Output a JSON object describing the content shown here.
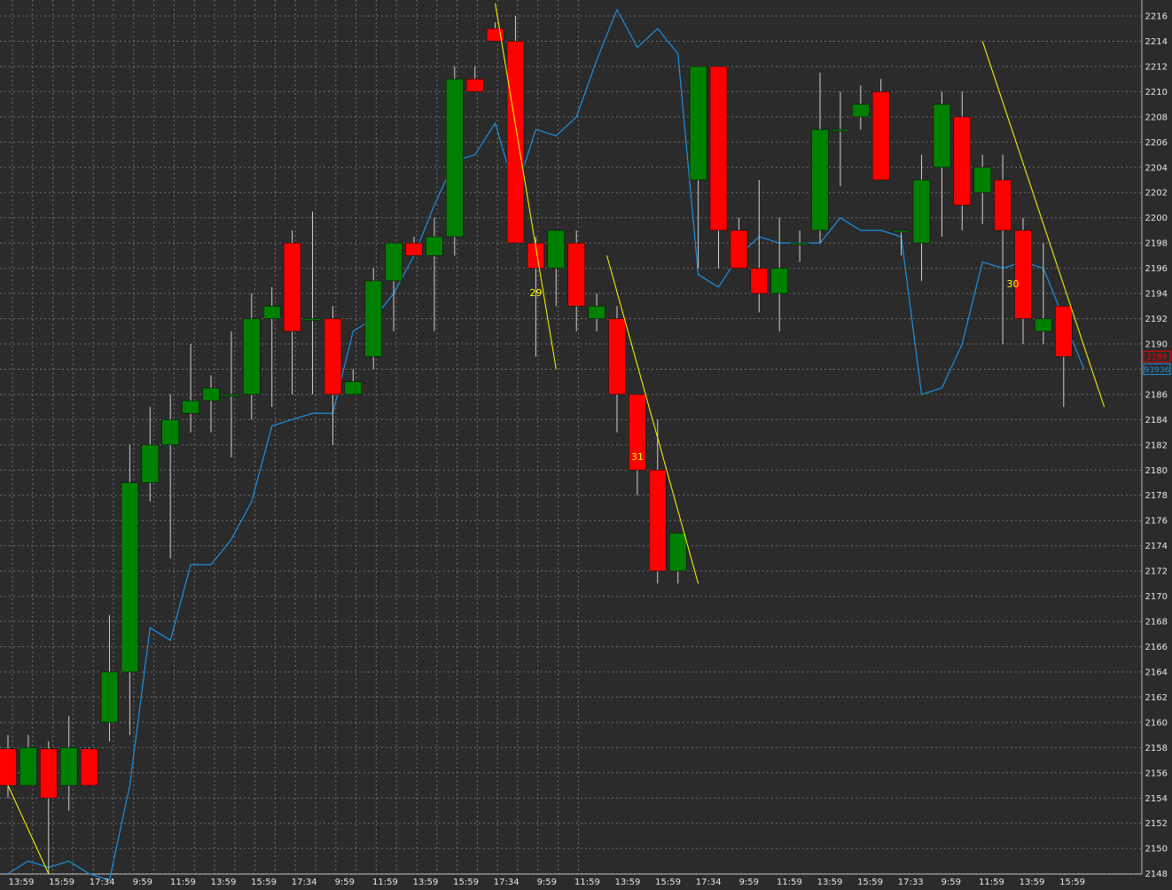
{
  "chart_data": {
    "type": "candlestick",
    "ylim": [
      2147,
      2217
    ],
    "y_ticks": [
      2148,
      2150,
      2152,
      2154,
      2156,
      2158,
      2160,
      2162,
      2164,
      2166,
      2168,
      2170,
      2172,
      2174,
      2176,
      2178,
      2180,
      2182,
      2184,
      2186,
      2188,
      2190,
      2192,
      2194,
      2196,
      2198,
      2200,
      2202,
      2204,
      2206,
      2208,
      2210,
      2212,
      2214,
      2216
    ],
    "x_tick_labels": [
      "13:59",
      "15:59",
      "17:34",
      "9:59",
      "11:59",
      "13:59",
      "15:59",
      "17:34",
      "9:59",
      "11:59",
      "13:59",
      "15:59",
      "17:34",
      "9:59",
      "11:59",
      "13:59",
      "15:59",
      "17:34",
      "9:59",
      "11:59",
      "13:59",
      "15:59",
      "17:33",
      "9:59",
      "11:59",
      "13:59",
      "15:59"
    ],
    "grid": true,
    "colors": {
      "background": "#2b2b2b",
      "grid": "#6e6e6e",
      "up": "#008000",
      "down": "#ff0000",
      "wick": "#d0d0d0",
      "indicator": "#1e90e0",
      "trendline": "#ffff00",
      "axis_text": "#e6e6e6"
    },
    "candles": [
      {
        "o": 2157.9,
        "h": 2159.0,
        "l": 2154.0,
        "c": 2155.0
      },
      {
        "o": 2155.0,
        "h": 2159.0,
        "l": 2155.0,
        "c": 2158.0
      },
      {
        "o": 2157.9,
        "h": 2158.5,
        "l": 2148.0,
        "c": 2154.0
      },
      {
        "o": 2155.0,
        "h": 2160.5,
        "l": 2153.0,
        "c": 2158.0
      },
      {
        "o": 2157.9,
        "h": 2158.0,
        "l": 2155.0,
        "c": 2155.0
      },
      {
        "o": 2160.0,
        "h": 2168.5,
        "l": 2158.5,
        "c": 2164.0
      },
      {
        "o": 2164.0,
        "h": 2182.0,
        "l": 2159.0,
        "c": 2179.0
      },
      {
        "o": 2179.0,
        "h": 2185.0,
        "l": 2177.5,
        "c": 2182.0
      },
      {
        "o": 2182.0,
        "h": 2186.0,
        "l": 2173.0,
        "c": 2184.0
      },
      {
        "o": 2184.5,
        "h": 2190.0,
        "l": 2183.0,
        "c": 2185.5
      },
      {
        "o": 2185.5,
        "h": 2187.5,
        "l": 2183.0,
        "c": 2186.5
      },
      {
        "o": 2186.0,
        "h": 2191.0,
        "l": 2181.0,
        "c": 2186.0
      },
      {
        "o": 2186.0,
        "h": 2194.0,
        "l": 2184.0,
        "c": 2192.0
      },
      {
        "o": 2192.0,
        "h": 2194.5,
        "l": 2185.0,
        "c": 2193.0
      },
      {
        "o": 2198.0,
        "h": 2199.0,
        "l": 2186.0,
        "c": 2191.0
      },
      {
        "o": 2192.0,
        "h": 2200.5,
        "l": 2186.0,
        "c": 2192.0
      },
      {
        "o": 2192.0,
        "h": 2193.0,
        "l": 2182.0,
        "c": 2186.0
      },
      {
        "o": 2186.0,
        "h": 2188.0,
        "l": 2186.0,
        "c": 2187.0
      },
      {
        "o": 2189.0,
        "h": 2196.0,
        "l": 2188.0,
        "c": 2195.0
      },
      {
        "o": 2195.0,
        "h": 2198.0,
        "l": 2191.0,
        "c": 2198.0
      },
      {
        "o": 2198.0,
        "h": 2198.5,
        "l": 2197.0,
        "c": 2197.0
      },
      {
        "o": 2197.0,
        "h": 2200.0,
        "l": 2191.0,
        "c": 2198.5
      },
      {
        "o": 2198.5,
        "h": 2212.0,
        "l": 2197.0,
        "c": 2211.0
      },
      {
        "o": 2211.0,
        "h": 2212.0,
        "l": 2210.0,
        "c": 2210.0
      },
      {
        "o": 2215.0,
        "h": 2215.5,
        "l": 2214.0,
        "c": 2214.0
      },
      {
        "o": 2214.0,
        "h": 2216.0,
        "l": 2198.0,
        "c": 2198.0
      },
      {
        "o": 2198.0,
        "h": 2198.5,
        "l": 2189.0,
        "c": 2196.0
      },
      {
        "o": 2196.0,
        "h": 2199.0,
        "l": 2193.0,
        "c": 2199.0
      },
      {
        "o": 2198.0,
        "h": 2199.0,
        "l": 2191.0,
        "c": 2193.0
      },
      {
        "o": 2192.0,
        "h": 2194.0,
        "l": 2191.0,
        "c": 2193.0
      },
      {
        "o": 2192.0,
        "h": 2193.0,
        "l": 2183.0,
        "c": 2186.0
      },
      {
        "o": 2186.0,
        "h": 2186.0,
        "l": 2178.0,
        "c": 2180.0
      },
      {
        "o": 2180.0,
        "h": 2184.0,
        "l": 2171.0,
        "c": 2172.0
      },
      {
        "o": 2172.0,
        "h": 2175.0,
        "l": 2171.0,
        "c": 2175.0
      },
      {
        "o": 2203.0,
        "h": 2212.0,
        "l": 2196.0,
        "c": 2212.0
      },
      {
        "o": 2212.0,
        "h": 2212.0,
        "l": 2196.0,
        "c": 2199.0
      },
      {
        "o": 2199.0,
        "h": 2200.0,
        "l": 2196.0,
        "c": 2196.0
      },
      {
        "o": 2196.0,
        "h": 2203.0,
        "l": 2192.5,
        "c": 2194.0
      },
      {
        "o": 2194.0,
        "h": 2200.0,
        "l": 2191.0,
        "c": 2196.0
      },
      {
        "o": 2198.0,
        "h": 2199.0,
        "l": 2196.5,
        "c": 2198.0
      },
      {
        "o": 2199.0,
        "h": 2211.5,
        "l": 2198.0,
        "c": 2207.0
      },
      {
        "o": 2207.0,
        "h": 2210.0,
        "l": 2202.5,
        "c": 2207.0
      },
      {
        "o": 2208.0,
        "h": 2210.5,
        "l": 2207.0,
        "c": 2209.0
      },
      {
        "o": 2210.0,
        "h": 2211.0,
        "l": 2203.0,
        "c": 2203.0
      },
      {
        "o": 2199.0,
        "h": 2199.0,
        "l": 2197.0,
        "c": 2199.0
      },
      {
        "o": 2198.0,
        "h": 2205.0,
        "l": 2195.0,
        "c": 2203.0
      },
      {
        "o": 2204.0,
        "h": 2210.0,
        "l": 2198.5,
        "c": 2209.0
      },
      {
        "o": 2208.0,
        "h": 2210.0,
        "l": 2199.0,
        "c": 2201.0
      },
      {
        "o": 2202.0,
        "h": 2205.0,
        "l": 2199.5,
        "c": 2204.0
      },
      {
        "o": 2203.0,
        "h": 2205.0,
        "l": 2190.0,
        "c": 2199.0
      },
      {
        "o": 2199.0,
        "h": 2200.0,
        "l": 2190.0,
        "c": 2192.0
      },
      {
        "o": 2191.0,
        "h": 2198.0,
        "l": 2190.0,
        "c": 2192.0
      },
      {
        "o": 2193.0,
        "h": 2193.0,
        "l": 2185.0,
        "c": 2189.0
      }
    ],
    "indicator": {
      "values": [
        2148,
        2149,
        2148.5,
        2149,
        2148,
        2147.5,
        2155,
        2167.5,
        2166.5,
        2172.5,
        2172.5,
        2174.5,
        2177.5,
        2183.5,
        2184.0,
        2184.5,
        2184.5,
        2191.0,
        2192.0,
        2194.0,
        2197.0,
        2201.0,
        2204.5,
        2205.0,
        2207.5,
        2202.0,
        2207.0,
        2206.5,
        2208.0,
        2212.5,
        2216.5,
        2213.5,
        2215.0,
        2213.0,
        2195.5,
        2194.5,
        2197.0,
        2198.5,
        2198.0,
        2198.0,
        2198.0,
        2200.0,
        2199.0,
        2199.0,
        2198.5,
        2186.0,
        2186.5,
        2190.0,
        2196.5,
        2196.0,
        2196.5,
        2196.0,
        2192.0,
        2188.0
      ]
    },
    "trendlines": [
      {
        "start": [
          0,
          2155.0
        ],
        "end": [
          2,
          2148.0
        ]
      },
      {
        "start": [
          24,
          2217.0
        ],
        "end": [
          27,
          2188.0
        ]
      },
      {
        "start": [
          29.5,
          2197.0
        ],
        "end": [
          34,
          2171.0
        ]
      },
      {
        "start": [
          48,
          2214.0
        ],
        "end": [
          54,
          2185.0
        ]
      }
    ],
    "annotations": [
      {
        "text": "29",
        "at": [
          26,
          2193.8
        ]
      },
      {
        "text": "31",
        "at": [
          31,
          2180.8
        ]
      },
      {
        "text": "30",
        "at": [
          49.5,
          2194.5
        ]
      }
    ],
    "last_price": {
      "text": "2189",
      "value": 2189,
      "color": "#ff0000"
    },
    "last_indicator": {
      "text": "93936",
      "value": 2188,
      "color": "#1e90e0"
    }
  }
}
